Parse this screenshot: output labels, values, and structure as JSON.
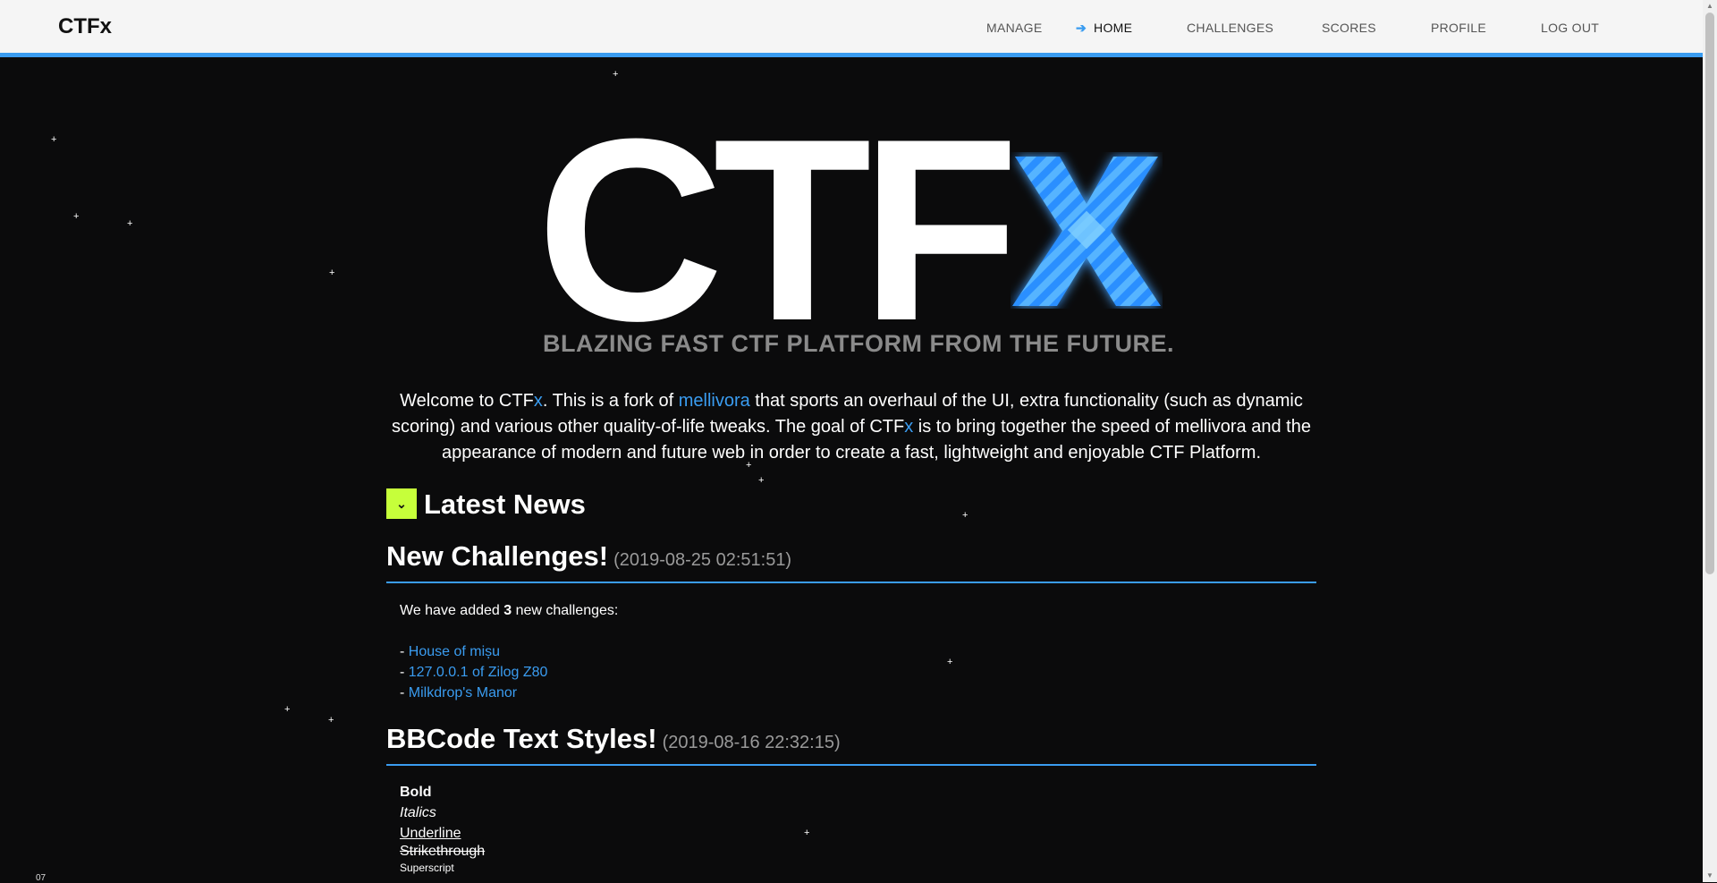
{
  "brand": "CTFx",
  "nav": {
    "manage": "MANAGE",
    "home": "HOME",
    "challenges": "CHALLENGES",
    "scores": "SCORES",
    "profile": "PROFILE",
    "logout": "LOG OUT"
  },
  "hero": {
    "logo_main": "CTF",
    "logo_x": "x",
    "tagline": "BLAZING FAST CTF PLATFORM FROM THE FUTURE."
  },
  "intro": {
    "p1": "Welcome to CTF",
    "x1": "x",
    "p2": ". This is a fork of ",
    "link": "mellivora",
    "p3": " that sports an overhaul of the UI, extra functionality (such as dynamic scoring) and various other quality-of-life tweaks. The goal of CTF",
    "x2": "x",
    "p4": " is to bring together the speed of mellivora and the appearance of modern and future web in order to create a fast, lightweight and enjoyable CTF Platform."
  },
  "news": {
    "heading": "Latest News",
    "toggle_icon": "chevron-down",
    "posts": [
      {
        "title": "New Challenges!",
        "date": "(2019-08-25 02:51:51)",
        "intro_pre": "We have added ",
        "intro_bold": "3",
        "intro_post": " new challenges:",
        "items": [
          "House of mișu",
          "127.0.0.1 of Zilog Z80",
          "Milkdrop's Manor"
        ]
      },
      {
        "title": "BBCode Text Styles!",
        "date": "(2019-08-16 22:32:15)",
        "styles": {
          "bold": "Bold",
          "italics": "Italics",
          "underline": "Underline",
          "strikethrough": "Strikethrough",
          "superscript": "Superscript"
        }
      }
    ]
  },
  "corner_text": "07",
  "colors": {
    "accent": "#3a9cf0",
    "toggle": "#c6ff3a",
    "background": "#0b0b0c",
    "navbar": "#f5f5f5"
  }
}
